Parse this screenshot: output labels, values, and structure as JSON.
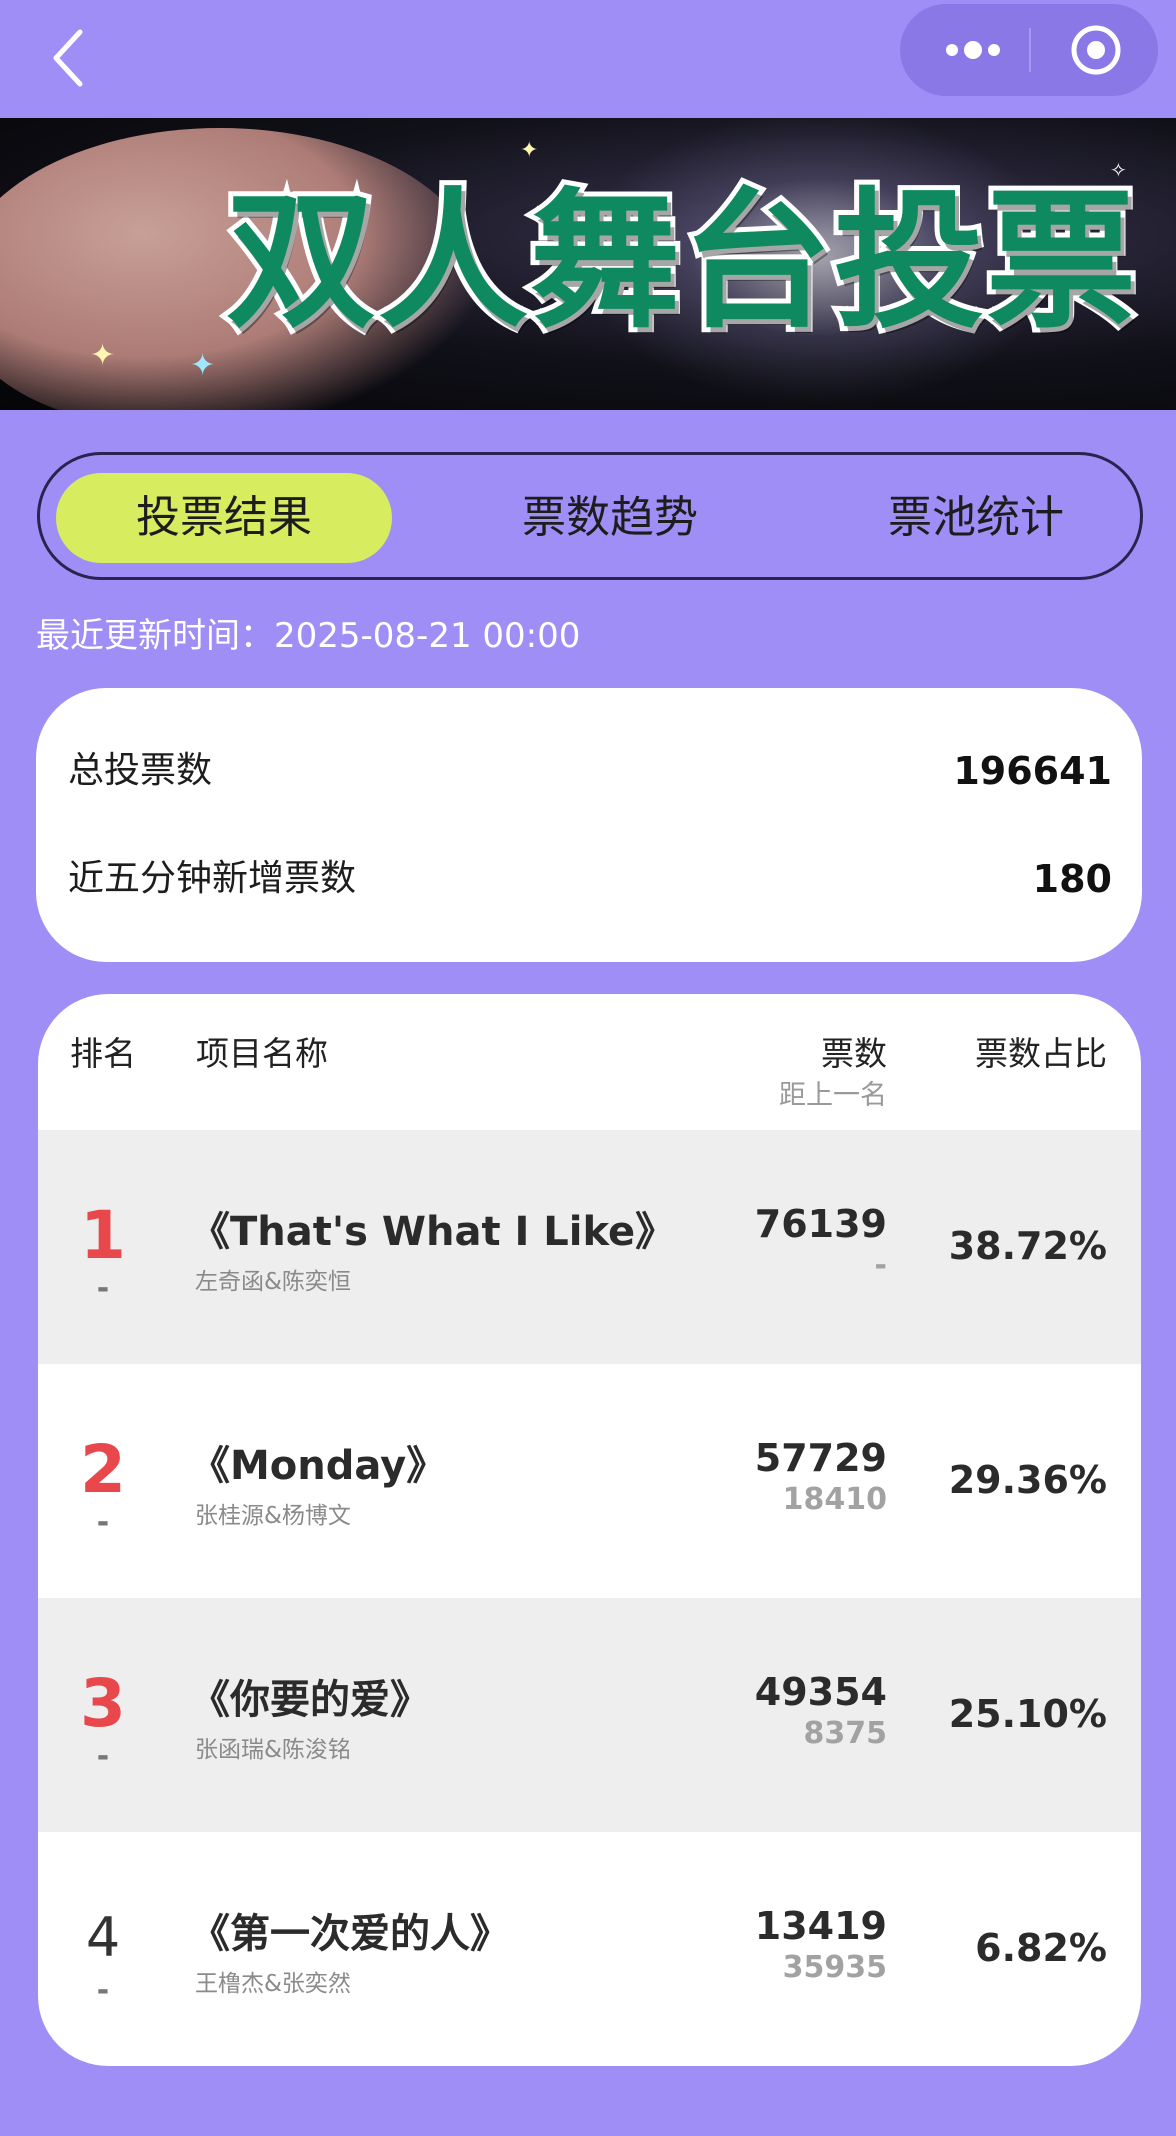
{
  "nav": {
    "back_icon": "chevron-left-icon",
    "more_icon": "more-dots-icon",
    "close_icon": "target-circle-icon"
  },
  "banner": {
    "title": "双人舞台投票"
  },
  "tabs": [
    {
      "label": "投票结果",
      "active": true
    },
    {
      "label": "票数趋势",
      "active": false
    },
    {
      "label": "票池统计",
      "active": false
    }
  ],
  "update_time": "最近更新时间：2025-08-21 00:00",
  "summary": {
    "total_label": "总投票数",
    "total_value": "196641",
    "recent_label": "近五分钟新增票数",
    "recent_value": "180"
  },
  "table": {
    "headers": {
      "rank": "排名",
      "name": "项目名称",
      "votes": "票数",
      "votes_sub": "距上一名",
      "share": "票数占比"
    },
    "rows": [
      {
        "rank": "1",
        "trend": "-",
        "song": "《That's What I Like》",
        "artists": "左奇函&陈奕恒",
        "votes": "76139",
        "gap": "-",
        "share": "38.72%"
      },
      {
        "rank": "2",
        "trend": "-",
        "song": "《Monday》",
        "artists": "张桂源&杨博文",
        "votes": "57729",
        "gap": "18410",
        "share": "29.36%"
      },
      {
        "rank": "3",
        "trend": "-",
        "song": "《你要的爱》",
        "artists": "张函瑞&陈浚铭",
        "votes": "49354",
        "gap": "8375",
        "share": "25.10%"
      },
      {
        "rank": "4",
        "trend": "-",
        "song": "《第一次爱的人》",
        "artists": "王橹杰&张奕然",
        "votes": "13419",
        "gap": "35935",
        "share": "6.82%"
      }
    ]
  },
  "colors": {
    "background": "#a08ef7",
    "active_tab": "#d8ec5f",
    "rank_top": "#e8474b",
    "banner_text": "#0f8a60"
  }
}
